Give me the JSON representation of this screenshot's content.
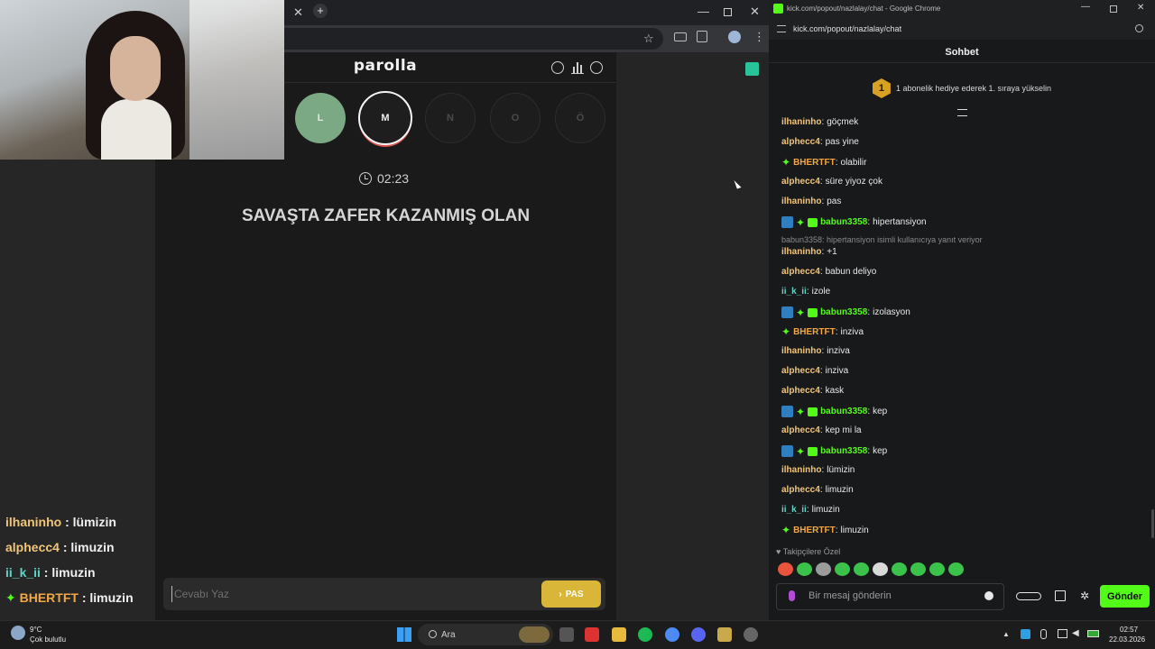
{
  "game_window": {
    "title": "parolla",
    "letters": [
      {
        "label": "L",
        "state": "done"
      },
      {
        "label": "M",
        "state": "active"
      },
      {
        "label": "N",
        "state": "idle"
      },
      {
        "label": "O",
        "state": "idle"
      },
      {
        "label": "Ö",
        "state": "idle"
      }
    ],
    "timer": "02:23",
    "question": "SAVAŞTA ZAFER KAZANMIŞ OLAN",
    "answer_placeholder": "Cevabı Yaz",
    "pas_label": "PAS"
  },
  "overlay_chat": [
    {
      "user": "ilhaninho",
      "text": " : lümizin",
      "color": "#f2c67a"
    },
    {
      "user": "alphecc4",
      "text": " : limuzin",
      "color": "#f2c67a"
    },
    {
      "user": "ii_k_ii",
      "text": " : limuzin",
      "color": "#60d3c5"
    },
    {
      "user": "BHERTFT",
      "text": " : limuzin",
      "color": "#f2a744"
    }
  ],
  "chat_window": {
    "window_title": "kick.com/popout/nazlalay/chat - Google Chrome",
    "url": "kick.com/popout/nazlalay/chat",
    "header": "Sohbet",
    "promo_badge": "1",
    "promo_text": "1 abonelik hediye ederek 1. sıraya yükselin",
    "messages": [
      {
        "user": "ilhaninho",
        "text": "göçmek",
        "color": "#f2c67a",
        "badges": ""
      },
      {
        "user": "alphecc4",
        "text": "pas yine",
        "color": "#f2c67a",
        "badges": ""
      },
      {
        "user": "BHERTFT",
        "text": "olabilir",
        "color": "#f2a744",
        "badges": "star"
      },
      {
        "user": "alphecc4",
        "text": "süre yiyoz çok",
        "color": "#f2c67a",
        "badges": ""
      },
      {
        "user": "ilhaninho",
        "text": "pas",
        "color": "#f2c67a",
        "badges": ""
      },
      {
        "user": "babun3358",
        "text": "hipertansiyon",
        "color": "#53fc18",
        "badges": "full"
      },
      {
        "user": "ilhaninho",
        "text": "+1",
        "color": "#f2c67a",
        "badges": "",
        "reply": "babun3358: hipertansiyon isimli kullanıcıya yanıt veriyor"
      },
      {
        "user": "alphecc4",
        "text": "babun deliyo",
        "color": "#f2c67a",
        "badges": ""
      },
      {
        "user": "ii_k_ii",
        "text": "izole",
        "color": "#60d3c5",
        "badges": ""
      },
      {
        "user": "babun3358",
        "text": "izolasyon",
        "color": "#53fc18",
        "badges": "full"
      },
      {
        "user": "BHERTFT",
        "text": "inziva",
        "color": "#f2a744",
        "badges": "star"
      },
      {
        "user": "ilhaninho",
        "text": "inziva",
        "color": "#f2c67a",
        "badges": ""
      },
      {
        "user": "alphecc4",
        "text": "inziva",
        "color": "#f2c67a",
        "badges": ""
      },
      {
        "user": "alphecc4",
        "text": "kask",
        "color": "#f2c67a",
        "badges": ""
      },
      {
        "user": "babun3358",
        "text": "kep",
        "color": "#53fc18",
        "badges": "full"
      },
      {
        "user": "alphecc4",
        "text": "kep mi la",
        "color": "#f2c67a",
        "badges": ""
      },
      {
        "user": "babun3358",
        "text": "kep",
        "color": "#53fc18",
        "badges": "full"
      },
      {
        "user": "ilhaninho",
        "text": "lümizin",
        "color": "#f2c67a",
        "badges": ""
      },
      {
        "user": "alphecc4",
        "text": "limuzin",
        "color": "#f2c67a",
        "badges": ""
      },
      {
        "user": "ii_k_ii",
        "text": "limuzin",
        "color": "#60d3c5",
        "badges": ""
      },
      {
        "user": "BHERTFT",
        "text": "limuzin",
        "color": "#f2a744",
        "badges": "star"
      }
    ],
    "followers_label": "Takipçilere Özel",
    "message_placeholder": "Bir mesaj gönderin",
    "send_label": "Gönder"
  },
  "taskbar": {
    "weather_temp": "9°C",
    "weather_desc": "Çok bulutlu",
    "search_label": "Ara",
    "time": "02:57",
    "date": "22.03.2026"
  },
  "colors": {
    "kick_green": "#53fc18",
    "pas_yellow": "#d9b637",
    "done_green": "#7aa983"
  }
}
